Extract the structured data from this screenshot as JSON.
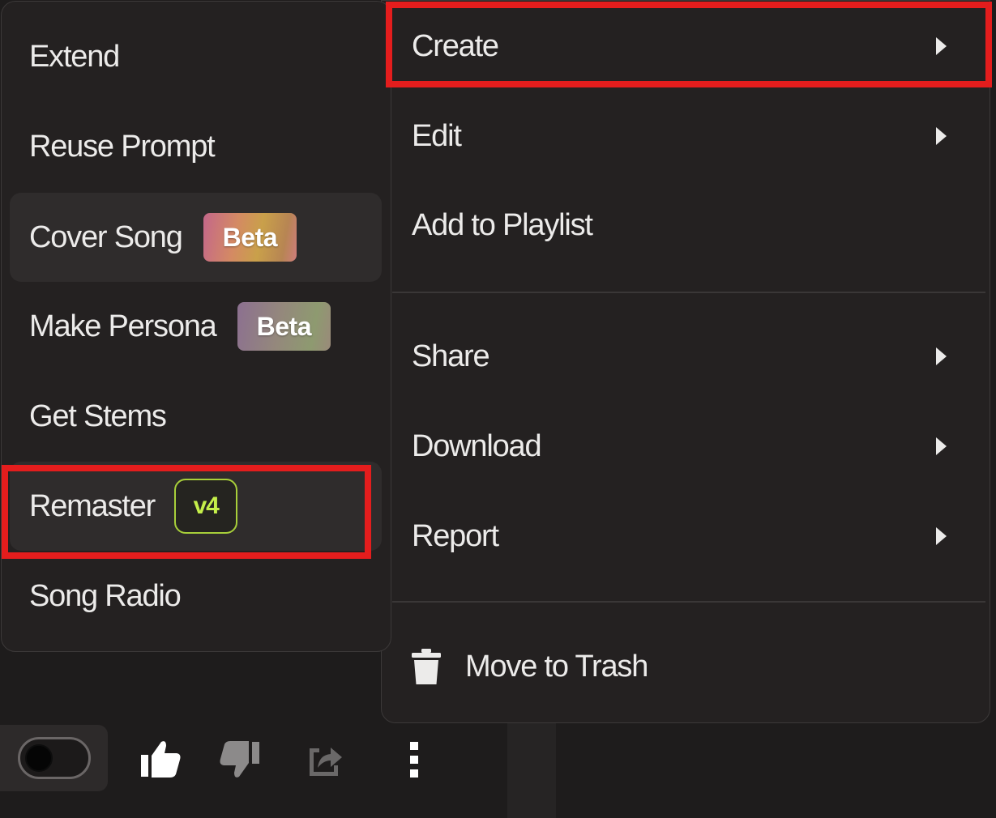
{
  "submenu": {
    "items": [
      {
        "label": "Extend"
      },
      {
        "label": "Reuse Prompt"
      },
      {
        "label": "Cover Song",
        "badge": "Beta"
      },
      {
        "label": "Make Persona",
        "badge": "Beta"
      },
      {
        "label": "Get Stems"
      },
      {
        "label": "Remaster",
        "badge": "v4"
      },
      {
        "label": "Song Radio"
      }
    ]
  },
  "menu": {
    "items": [
      {
        "label": "Create",
        "has_submenu": true
      },
      {
        "label": "Edit",
        "has_submenu": true
      },
      {
        "label": "Add to Playlist",
        "has_submenu": false
      },
      {
        "label": "Share",
        "has_submenu": true
      },
      {
        "label": "Download",
        "has_submenu": true
      },
      {
        "label": "Report",
        "has_submenu": true
      },
      {
        "label": "Move to Trash",
        "icon": "trash-icon"
      }
    ]
  },
  "toolbar": {
    "toggle_on": false,
    "icons": [
      "thumbs-up-icon",
      "thumbs-down-icon",
      "share-icon",
      "more-vertical-icon"
    ]
  },
  "colors": {
    "background": "#1e1c1c",
    "menu_bg": "#242121",
    "highlight": "#e41d1d",
    "v4_accent": "#c5ef4a"
  }
}
